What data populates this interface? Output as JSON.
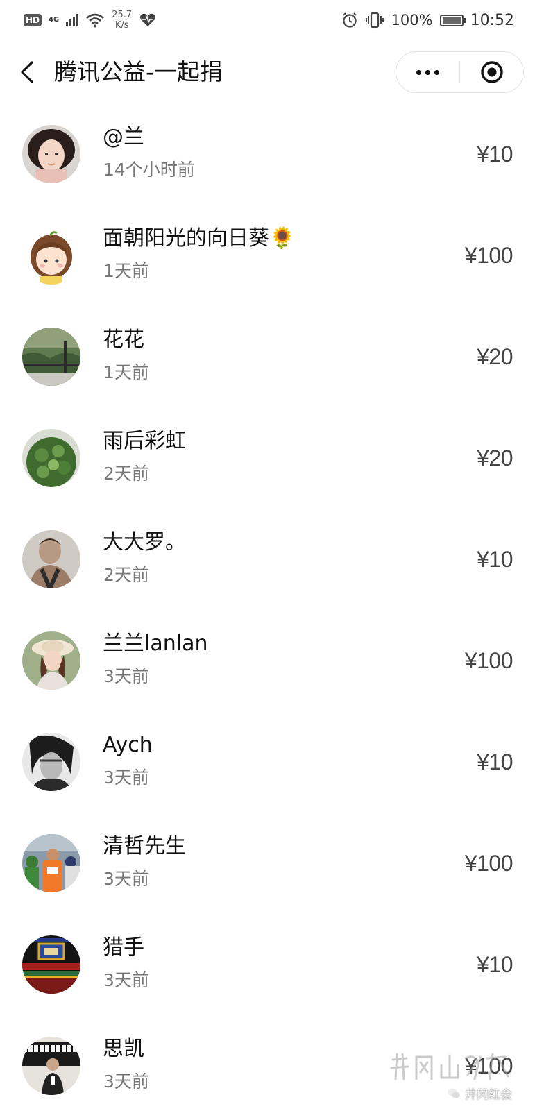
{
  "status_bar": {
    "hd": "HD",
    "network": "4G",
    "speed_value": "25.7",
    "speed_unit": "K/s",
    "battery_text": "100%",
    "time": "10:52",
    "icons": [
      "signal-icon",
      "wifi-icon",
      "heart-rate-icon",
      "alarm-icon",
      "vibrate-icon",
      "battery-icon"
    ]
  },
  "nav": {
    "title": "腾讯公益-一起捐",
    "back_icon": "chevron-left-icon",
    "more_icon": "more-dots-icon",
    "close_icon": "target-close-icon"
  },
  "donors": [
    {
      "name": "@兰",
      "time": "14个小时前",
      "amount": "¥10",
      "avatar": "avatar-photo-woman"
    },
    {
      "name": "面朝阳光的向日葵🌻",
      "time": "1天前",
      "amount": "¥100",
      "avatar": "avatar-cartoon-girl"
    },
    {
      "name": "花花",
      "time": "1天前",
      "amount": "¥20",
      "avatar": "avatar-plants"
    },
    {
      "name": "雨后彩虹",
      "time": "2天前",
      "amount": "¥20",
      "avatar": "avatar-leaves"
    },
    {
      "name": "大大罗。",
      "time": "2天前",
      "amount": "¥10",
      "avatar": "avatar-photo-man"
    },
    {
      "name": "兰兰lanlan",
      "time": "3天前",
      "amount": "¥100",
      "avatar": "avatar-photo-woman-hat"
    },
    {
      "name": "Aych",
      "time": "3天前",
      "amount": "¥10",
      "avatar": "avatar-photo-bw"
    },
    {
      "name": "清哲先生",
      "time": "3天前",
      "amount": "¥100",
      "avatar": "avatar-photo-runners"
    },
    {
      "name": "猎手",
      "time": "3天前",
      "amount": "¥10",
      "avatar": "avatar-photo-gate"
    },
    {
      "name": "思凯",
      "time": "3天前",
      "amount": "¥100",
      "avatar": "avatar-photo-piano"
    }
  ],
  "watermark": {
    "account": "井冈红会"
  },
  "colors": {
    "background": "#ffffff",
    "text_primary": "#111111",
    "text_secondary": "#777777",
    "amount": "#444444"
  }
}
